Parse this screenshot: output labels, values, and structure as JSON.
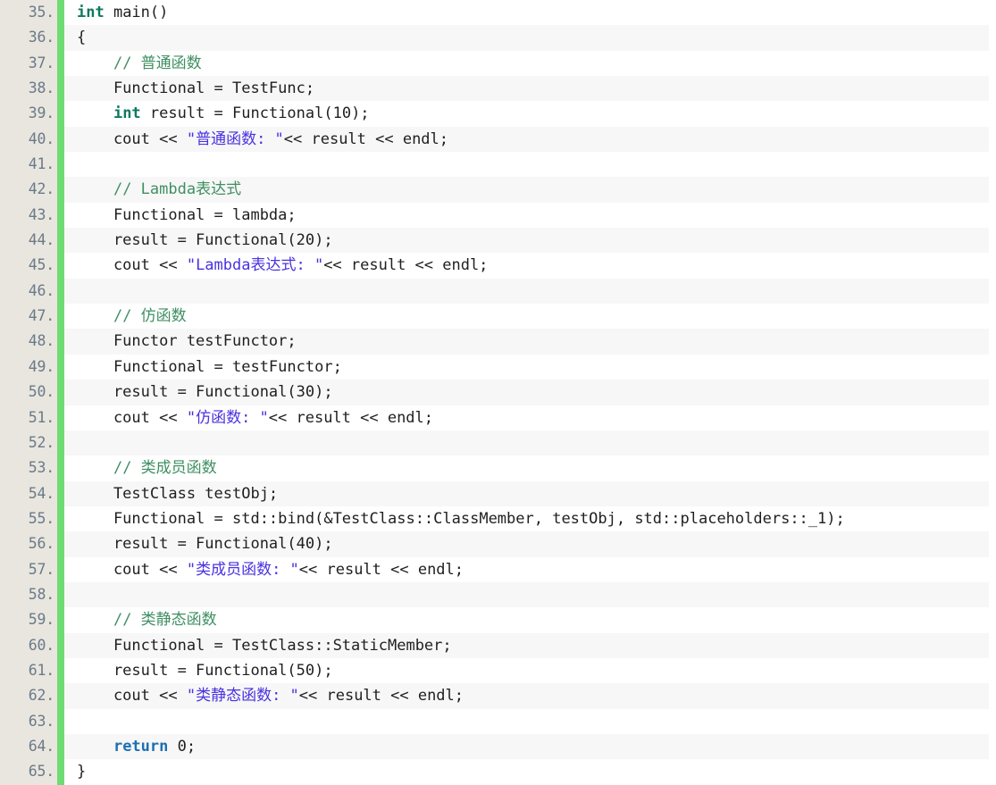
{
  "editor": {
    "language": "C++",
    "first_line_number": 35,
    "last_line_number": 65,
    "colors": {
      "gutter_background": "#e8e6de",
      "gutter_text": "#6b7a8a",
      "change_bar_green": "#6edc73",
      "row_background_odd": "#ffffff",
      "row_background_even": "#f7f7f7",
      "keyword_type": "#0d7a5f",
      "keyword_return": "#1f6fb2",
      "comment": "#3f8f62",
      "string": "#4a31e0",
      "plain_text": "#1f1f1f"
    }
  },
  "lines": [
    {
      "number": "35.",
      "tokens": [
        {
          "t": "int",
          "c": "tok-kw"
        },
        {
          "t": " main()",
          "c": "tok-plain"
        }
      ]
    },
    {
      "number": "36.",
      "tokens": [
        {
          "t": "{",
          "c": "tok-plain"
        }
      ]
    },
    {
      "number": "37.",
      "tokens": [
        {
          "t": "    ",
          "c": "tok-plain"
        },
        {
          "t": "// 普通函数",
          "c": "tok-comment"
        }
      ]
    },
    {
      "number": "38.",
      "tokens": [
        {
          "t": "    Functional = TestFunc;",
          "c": "tok-plain"
        }
      ]
    },
    {
      "number": "39.",
      "tokens": [
        {
          "t": "    ",
          "c": "tok-plain"
        },
        {
          "t": "int",
          "c": "tok-kw"
        },
        {
          "t": " result = Functional(10);",
          "c": "tok-plain"
        }
      ]
    },
    {
      "number": "40.",
      "tokens": [
        {
          "t": "    cout << ",
          "c": "tok-plain"
        },
        {
          "t": "\"普通函数: \"",
          "c": "tok-string"
        },
        {
          "t": "<< result << endl;",
          "c": "tok-plain"
        }
      ]
    },
    {
      "number": "41.",
      "tokens": []
    },
    {
      "number": "42.",
      "tokens": [
        {
          "t": "    ",
          "c": "tok-plain"
        },
        {
          "t": "// Lambda表达式",
          "c": "tok-comment"
        }
      ]
    },
    {
      "number": "43.",
      "tokens": [
        {
          "t": "    Functional = lambda;",
          "c": "tok-plain"
        }
      ]
    },
    {
      "number": "44.",
      "tokens": [
        {
          "t": "    result = Functional(20);",
          "c": "tok-plain"
        }
      ]
    },
    {
      "number": "45.",
      "tokens": [
        {
          "t": "    cout << ",
          "c": "tok-plain"
        },
        {
          "t": "\"Lambda表达式: \"",
          "c": "tok-string"
        },
        {
          "t": "<< result << endl;",
          "c": "tok-plain"
        }
      ]
    },
    {
      "number": "46.",
      "tokens": []
    },
    {
      "number": "47.",
      "tokens": [
        {
          "t": "    ",
          "c": "tok-plain"
        },
        {
          "t": "// 仿函数",
          "c": "tok-comment"
        }
      ]
    },
    {
      "number": "48.",
      "tokens": [
        {
          "t": "    Functor testFunctor;",
          "c": "tok-plain"
        }
      ]
    },
    {
      "number": "49.",
      "tokens": [
        {
          "t": "    Functional = testFunctor;",
          "c": "tok-plain"
        }
      ]
    },
    {
      "number": "50.",
      "tokens": [
        {
          "t": "    result = Functional(30);",
          "c": "tok-plain"
        }
      ]
    },
    {
      "number": "51.",
      "tokens": [
        {
          "t": "    cout << ",
          "c": "tok-plain"
        },
        {
          "t": "\"仿函数: \"",
          "c": "tok-string"
        },
        {
          "t": "<< result << endl;",
          "c": "tok-plain"
        }
      ]
    },
    {
      "number": "52.",
      "tokens": []
    },
    {
      "number": "53.",
      "tokens": [
        {
          "t": "    ",
          "c": "tok-plain"
        },
        {
          "t": "// 类成员函数",
          "c": "tok-comment"
        }
      ]
    },
    {
      "number": "54.",
      "tokens": [
        {
          "t": "    TestClass testObj;",
          "c": "tok-plain"
        }
      ]
    },
    {
      "number": "55.",
      "tokens": [
        {
          "t": "    Functional = std::bind(&TestClass::ClassMember, testObj, std::placeholders::_1);",
          "c": "tok-plain"
        }
      ]
    },
    {
      "number": "56.",
      "tokens": [
        {
          "t": "    result = Functional(40);",
          "c": "tok-plain"
        }
      ]
    },
    {
      "number": "57.",
      "tokens": [
        {
          "t": "    cout << ",
          "c": "tok-plain"
        },
        {
          "t": "\"类成员函数: \"",
          "c": "tok-string"
        },
        {
          "t": "<< result << endl;",
          "c": "tok-plain"
        }
      ]
    },
    {
      "number": "58.",
      "tokens": []
    },
    {
      "number": "59.",
      "tokens": [
        {
          "t": "    ",
          "c": "tok-plain"
        },
        {
          "t": "// 类静态函数",
          "c": "tok-comment"
        }
      ]
    },
    {
      "number": "60.",
      "tokens": [
        {
          "t": "    Functional = TestClass::StaticMember;",
          "c": "tok-plain"
        }
      ]
    },
    {
      "number": "61.",
      "tokens": [
        {
          "t": "    result = Functional(50);",
          "c": "tok-plain"
        }
      ]
    },
    {
      "number": "62.",
      "tokens": [
        {
          "t": "    cout << ",
          "c": "tok-plain"
        },
        {
          "t": "\"类静态函数: \"",
          "c": "tok-string"
        },
        {
          "t": "<< result << endl;",
          "c": "tok-plain"
        }
      ]
    },
    {
      "number": "63.",
      "tokens": []
    },
    {
      "number": "64.",
      "tokens": [
        {
          "t": "    ",
          "c": "tok-plain"
        },
        {
          "t": "return",
          "c": "tok-kw-ret"
        },
        {
          "t": " 0;",
          "c": "tok-plain"
        }
      ]
    },
    {
      "number": "65.",
      "tokens": [
        {
          "t": "}",
          "c": "tok-plain"
        }
      ]
    }
  ]
}
